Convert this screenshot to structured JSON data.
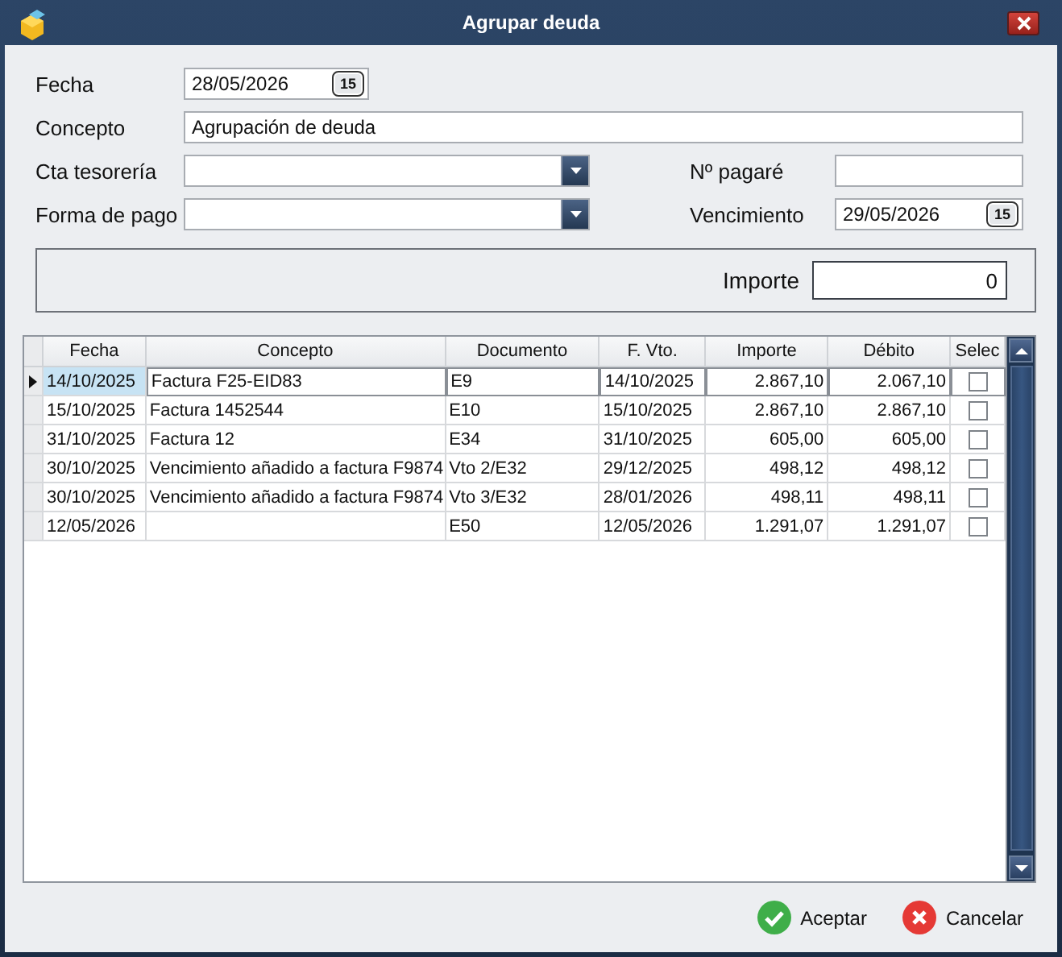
{
  "window": {
    "title": "Agrupar deuda"
  },
  "form": {
    "rows": [
      [
        {
          "label": "Fecha",
          "kind": "date",
          "value": "28/05/2026",
          "picker": "15"
        }
      ],
      [
        {
          "label": "Concepto",
          "kind": "text",
          "value": "Agrupación de deuda"
        }
      ],
      [
        {
          "label": "Cta tesorería",
          "kind": "combo"
        },
        {
          "label": "Nº pagaré",
          "kind": "text"
        }
      ],
      [
        {
          "label": "Forma de pago",
          "kind": "combo"
        },
        {
          "label": "Vencimiento",
          "kind": "date",
          "value": "29/05/2026",
          "picker": "15"
        }
      ]
    ]
  },
  "total": {
    "label": "Importe",
    "value": "0"
  },
  "table": {
    "columns": [
      {
        "label": "Fecha",
        "kind": "text"
      },
      {
        "label": "Concepto",
        "kind": "text"
      },
      {
        "label": "Documento",
        "kind": "text"
      },
      {
        "label": "F. Vto.",
        "kind": "text"
      },
      {
        "label": "Importe",
        "kind": "number"
      },
      {
        "label": "Débito",
        "kind": "number"
      },
      {
        "label": "Selec",
        "kind": "check"
      }
    ],
    "rows": [
      {
        "current": true,
        "cells": [
          "14/10/2025",
          "Factura F25-EID83",
          "E9",
          "14/10/2025",
          "2.867,10",
          "2.067,10"
        ],
        "checked": false
      },
      {
        "current": false,
        "cells": [
          "15/10/2025",
          "Factura 1452544",
          "E10",
          "15/10/2025",
          "2.867,10",
          "2.867,10"
        ],
        "checked": false
      },
      {
        "current": false,
        "cells": [
          "31/10/2025",
          "Factura 12",
          "E34",
          "31/10/2025",
          "605,00",
          "605,00"
        ],
        "checked": false
      },
      {
        "current": false,
        "cells": [
          "30/10/2025",
          "Vencimiento añadido a factura F9874",
          "Vto 2/E32",
          "29/12/2025",
          "498,12",
          "498,12"
        ],
        "checked": false
      },
      {
        "current": false,
        "cells": [
          "30/10/2025",
          "Vencimiento añadido a factura F9874",
          "Vto 3/E32",
          "28/01/2026",
          "498,11",
          "498,11"
        ],
        "checked": false
      },
      {
        "current": false,
        "cells": [
          "12/05/2026",
          null,
          "E50",
          "12/05/2026",
          "1.291,07",
          "1.291,07"
        ],
        "checked": false
      }
    ]
  },
  "buttons": [
    {
      "label": "Aceptar",
      "kind": "accept"
    },
    {
      "label": "Cancelar",
      "kind": "cancel"
    }
  ]
}
